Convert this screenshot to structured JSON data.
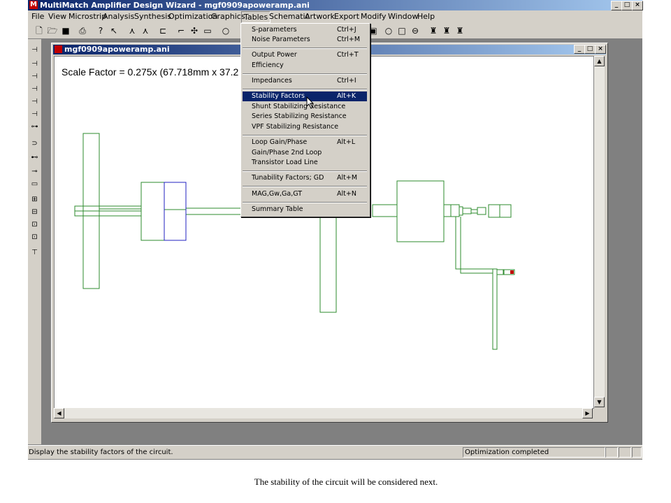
{
  "window": {
    "title": "MultiMatch Amplifier Design Wizard - mgf0909apoweramp.ani",
    "app_icon": "M",
    "controls": [
      "_",
      "□",
      "×"
    ]
  },
  "menubar": [
    "File",
    "View",
    "Microstrip",
    "Analysis",
    "Synthesis",
    "Optimization",
    "Graphics",
    "Tables",
    "Schematic",
    "Artwork",
    "Export",
    "Modify",
    "Window",
    "Help"
  ],
  "child_window": {
    "title": "mgf0909apoweramp.ani",
    "scale_factor": "Scale Factor =  0.275x (67.718mm x 37.2"
  },
  "tables_menu": {
    "items": [
      {
        "label": "S-parameters",
        "shortcut": "Ctrl+J"
      },
      {
        "label": "Noise Parameters",
        "shortcut": "Ctrl+M"
      },
      {
        "label": "Output Power",
        "shortcut": "Ctrl+T"
      },
      {
        "label": "Efficiency",
        "shortcut": ""
      },
      {
        "label": "Impedances",
        "shortcut": "Ctrl+I"
      },
      {
        "label": "Stability Factors",
        "shortcut": "Alt+K",
        "selected": true
      },
      {
        "label": "Shunt Stabilizing Resistance",
        "shortcut": ""
      },
      {
        "label": "Series Stabilizing Resistance",
        "shortcut": ""
      },
      {
        "label": "VPF Stabilizing Resistance",
        "shortcut": ""
      },
      {
        "label": "Loop Gain/Phase",
        "shortcut": "Alt+L"
      },
      {
        "label": "Gain/Phase 2nd Loop",
        "shortcut": ""
      },
      {
        "label": "Transistor Load Line",
        "shortcut": ""
      },
      {
        "label": "Tunability Factors; GD",
        "shortcut": "Alt+M"
      },
      {
        "label": "MAG,Gw,Ga,GT",
        "shortcut": "Alt+N"
      },
      {
        "label": "Summary Table",
        "shortcut": ""
      }
    ]
  },
  "statusbar": {
    "message": "Display the stability factors of the circuit.",
    "right": "Optimization completed"
  },
  "caption": "The stability of the circuit will be considered next.",
  "colors": {
    "circuit": "#2e8b2e",
    "selected_element": "#2020c0",
    "titlebar": "#0a246a",
    "menu_highlight": "#0a246a"
  }
}
